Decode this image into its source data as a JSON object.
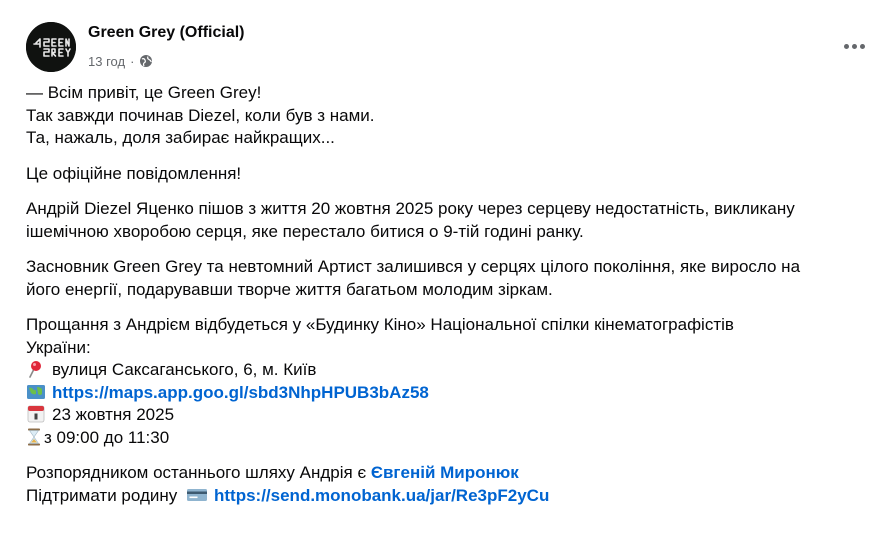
{
  "post": {
    "author": "Green Grey (Official)",
    "time": "13 год",
    "separator": "·",
    "avatar_text": "GREEN GREY",
    "privacy_icon": "globe-icon",
    "more_icon": "more-options-icon",
    "intro": [
      "— Всім привіт, це Green Grey!",
      "Так завжди починав Diezel, коли був з нами.",
      "Та, нажаль, доля забирає найкращих..."
    ],
    "official": "Це офіційне повідомлення!",
    "death_line1": "Андрій Diezel Яценко пішов з життя 20 жовтня 2025 року через серцеву недостатність, викликану",
    "death_line2": "ішемічною хворобою серця, яке перестало битися о 9-тій годині ранку.",
    "founder_line1": "Засновник Green Grey та невтомний Артист залишився у серцях цілого покоління, яке виросло на",
    "founder_line2": "його енергії, подарувавши творче життя багатьом молодим зіркам.",
    "farewell_line1": "Прощання з Андрієм відбудеться у «Будинку Кіно» Національної спілки кінематографістів",
    "farewell_line2": "України:",
    "address": "вулиця Саксаганського, 6, м. Київ",
    "maps_link": "https://maps.app.goo.gl/sbd3NhpHPUB3bAz58",
    "date": "23 жовтня 2025",
    "time_range": "з 09:00 до 11:30",
    "organizer_prefix": "Розпорядником останнього шляху Андрія є ",
    "organizer_name": "Євгеній Миронюк",
    "support_prefix": "Підтримати родину",
    "support_link": "https://send.monobank.ua/jar/Re3pF2yCu",
    "icons": {
      "address": "round-pushpin-icon",
      "maps": "world-map-icon",
      "date": "calendar-icon",
      "time": "hourglass-icon",
      "support": "credit-card-icon"
    },
    "colors": {
      "link": "#0064d1",
      "text": "#080809",
      "meta": "#65686c"
    }
  }
}
